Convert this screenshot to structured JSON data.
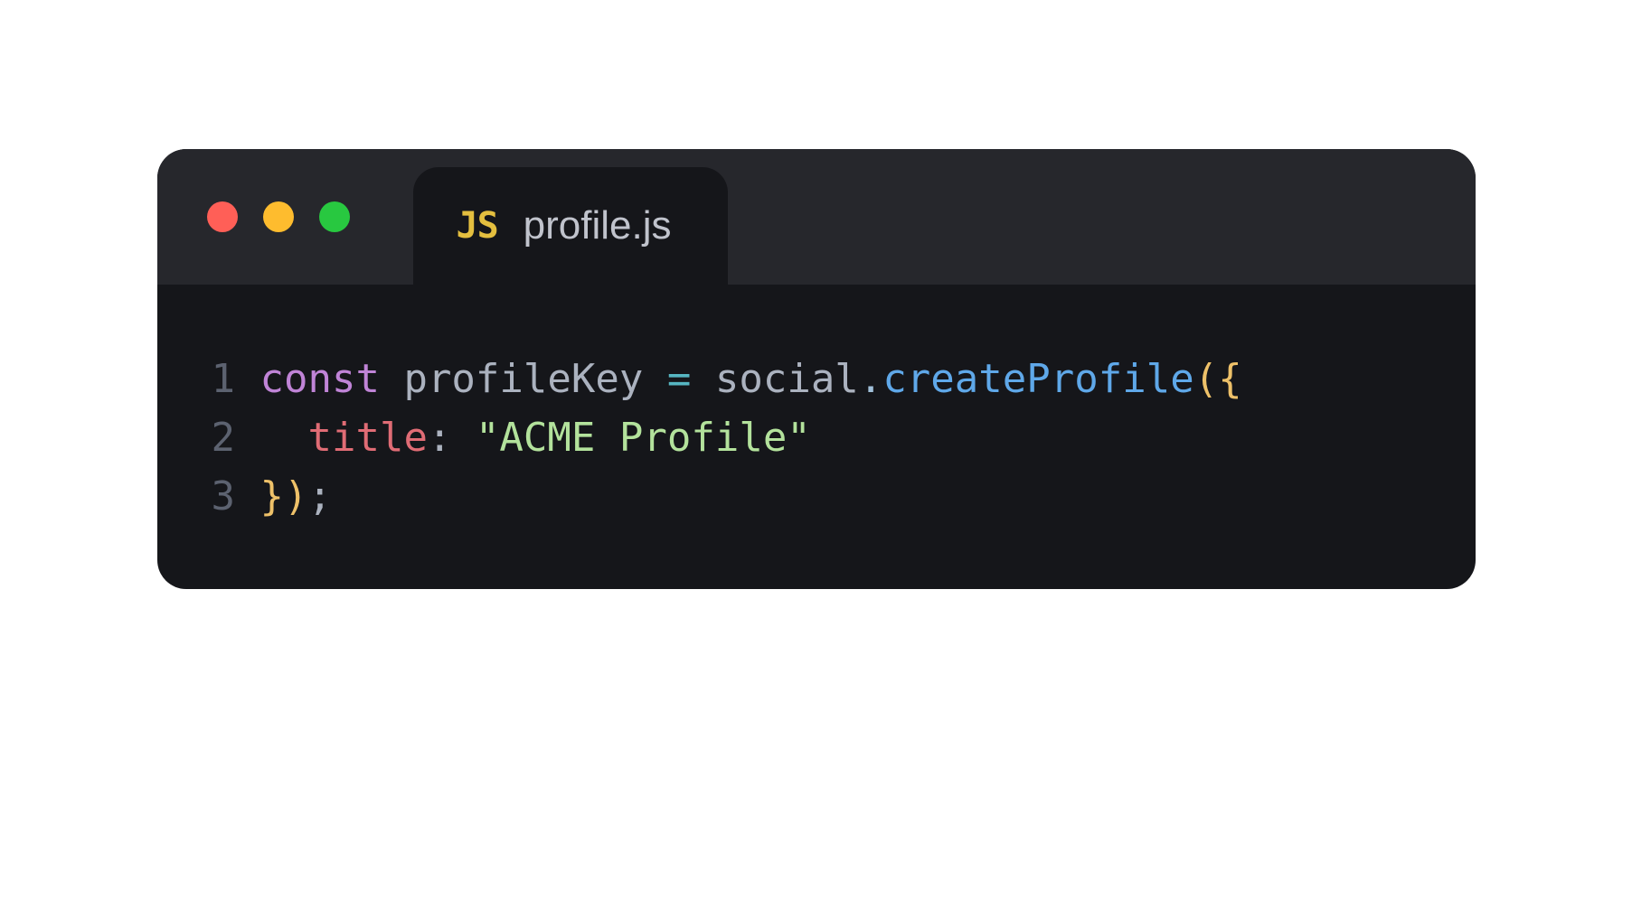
{
  "tab": {
    "icon_label": "JS",
    "filename": "profile.js"
  },
  "traffic_lights": {
    "red": "#ff5f57",
    "yellow": "#febc2e",
    "green": "#28c840"
  },
  "code": {
    "lines": [
      {
        "n": "1",
        "tokens": {
          "const": "const",
          "sp1": " ",
          "profileKey": "profileKey",
          "sp2": " ",
          "eq": "=",
          "sp3": " ",
          "social": "social",
          "dot": ".",
          "createProfile": "createProfile",
          "lparen": "(",
          "lbrace": "{"
        }
      },
      {
        "n": "2",
        "tokens": {
          "indent": "  ",
          "title": "title",
          "colon": ":",
          "sp1": " ",
          "string": "\"ACME Profile\""
        }
      },
      {
        "n": "3",
        "tokens": {
          "rbrace": "}",
          "rparen": ")",
          "semi": ";"
        }
      }
    ]
  }
}
